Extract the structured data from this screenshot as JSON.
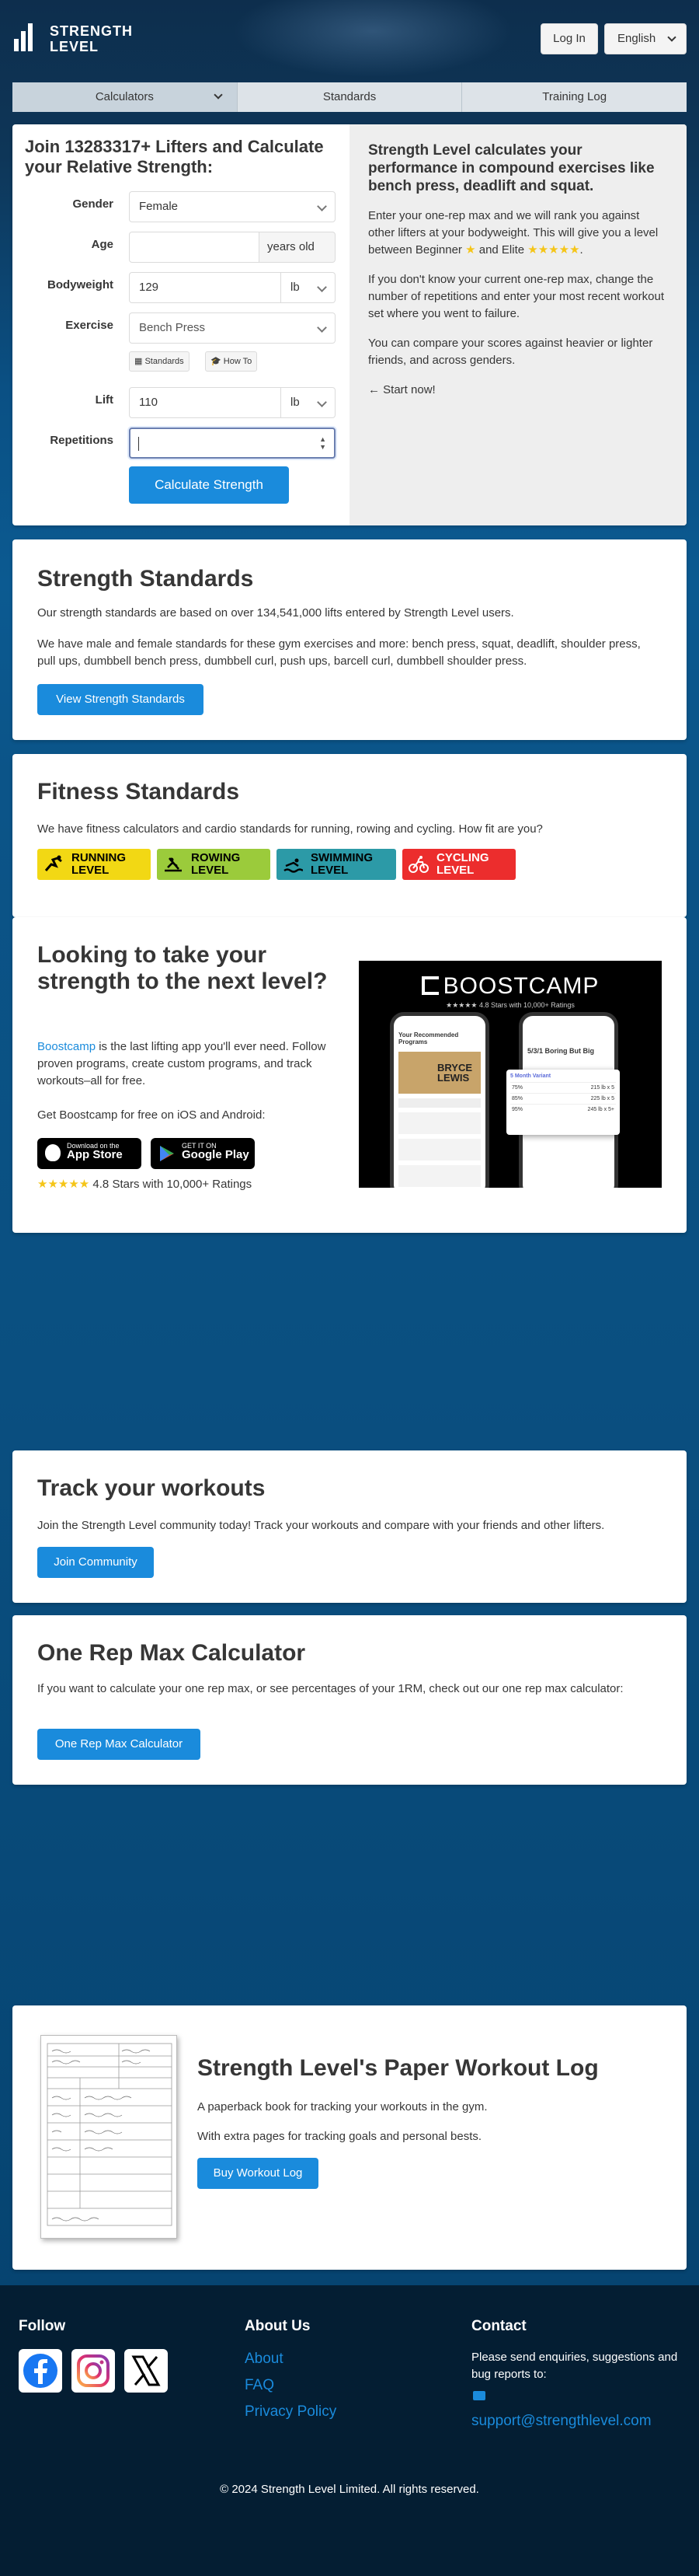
{
  "header": {
    "logo_line1": "STRENGTH",
    "logo_line2": "LEVEL",
    "login": "Log In",
    "language": "English"
  },
  "tabs": [
    "Calculators",
    "Standards",
    "Training Log"
  ],
  "calculator": {
    "title": "Join 13283317+ Lifters and Calculate your Relative Strength:",
    "gender_label": "Gender",
    "gender_value": "Female",
    "age_label": "Age",
    "age_value": "",
    "age_unit": "years old",
    "bodyweight_label": "Bodyweight",
    "bodyweight_value": "129",
    "bodyweight_unit": "lb",
    "exercise_label": "Exercise",
    "exercise_value": "Bench Press",
    "standards_btn": "Standards",
    "howto_btn": "How To",
    "lift_label": "Lift",
    "lift_value": "110",
    "lift_unit": "lb",
    "reps_label": "Repetitions",
    "reps_value": "",
    "submit": "Calculate Strength"
  },
  "intro": {
    "heading": "Strength Level calculates your performance in compound exercises like bench press, deadlift and squat.",
    "p1_a": "Enter your one-rep max and we will rank you against other lifters at your bodyweight. This will give you a level between Beginner",
    "p1_star1": "★",
    "p1_mid": "and Elite",
    "p1_stars5": "★★★★★",
    "p1_end": ".",
    "p2": "If you don't know your current one-rep max, change the number of repetitions and enter your most recent workout set where you went to failure.",
    "p3": "You can compare your scores against heavier or lighter friends, and across genders.",
    "start": "← Start now!"
  },
  "strength_standards": {
    "title": "Strength Standards",
    "p1": "Our strength standards are based on over 134,541,000 lifts entered by Strength Level users.",
    "p2": "We have male and female standards for these gym exercises and more: bench press, squat, deadlift, shoulder press, pull ups, dumbbell bench press, dumbbell curl, push ups, barcell curl, dumbbell shoulder press.",
    "button": "View Strength Standards"
  },
  "fitness_standards": {
    "title": "Fitness Standards",
    "text": "We have fitness calculators and cardio standards for running, rowing and cycling. How fit are you?",
    "badges": [
      {
        "line1": "RUNNING",
        "line2": "LEVEL",
        "color": "#f2d814",
        "text_color": "#000000"
      },
      {
        "line1": "ROWING",
        "line2": "LEVEL",
        "color": "#9bcb3b",
        "text_color": "#000000"
      },
      {
        "line1": "SWIMMING",
        "line2": "LEVEL",
        "color": "#2c9aa7",
        "text_color": "#000000"
      },
      {
        "line1": "CYCLING",
        "line2": "LEVEL",
        "color": "#ec2d2d",
        "text_color": "#ffffff"
      }
    ]
  },
  "boostcamp": {
    "title": "Looking to take your strength to the next level?",
    "link": "Boostcamp",
    "p1": " is the last lifting app you'll ever need. Follow proven programs, create custom programs, and track workouts–all for free.",
    "p2": "Get Boostcamp for free on iOS and Android:",
    "appstore_small": "Download on the",
    "appstore_big": "App Store",
    "play_small": "GET IT ON",
    "play_big": "Google Play",
    "stars": "★★★★★",
    "rating": "4.8 Stars with 10,000+ Ratings",
    "promo_brand": "BOOSTCAMP",
    "promo_rating": "★★★★★ 4.8 Stars with 10,000+ Ratings",
    "phone1_title": "Your Recommended Programs",
    "phone1_banner": "BRYCE LEWIS",
    "phone2_title": "5/3/1 Boring But Big",
    "phone2_week": "5 Month Variant",
    "phone2_rows": [
      [
        "75%",
        "215 lb x 5"
      ],
      [
        "85%",
        "225 lb x 5"
      ],
      [
        "95%",
        "245 lb x 5+"
      ]
    ]
  },
  "track": {
    "title": "Track your workouts",
    "text": "Join the Strength Level community today! Track your workouts and compare with your friends and other lifters.",
    "button": "Join Community"
  },
  "onerep": {
    "title": "One Rep Max Calculator",
    "text": "If you want to calculate your one rep max, or see percentages of your 1RM, check out our one rep max calculator:",
    "button": "One Rep Max Calculator"
  },
  "paperlog": {
    "title": "Strength Level's Paper Workout Log",
    "p1": "A paperback book for tracking your workouts in the gym.",
    "p2": "With extra pages for tracking goals and personal bests.",
    "button": "Buy Workout Log"
  },
  "footer": {
    "follow": "Follow",
    "about_title": "About Us",
    "about_links": [
      "About",
      "FAQ",
      "Privacy Policy"
    ],
    "contact_title": "Contact",
    "contact_text": "Please send enquiries, suggestions and bug reports to:",
    "email": "support@strengthlevel.com",
    "copyright": "© 2024 Strength Level Limited. All rights reserved."
  },
  "colors": {
    "primary": "#1a8bdc",
    "star": "#f5c518",
    "footer_bg": "#041e33"
  }
}
